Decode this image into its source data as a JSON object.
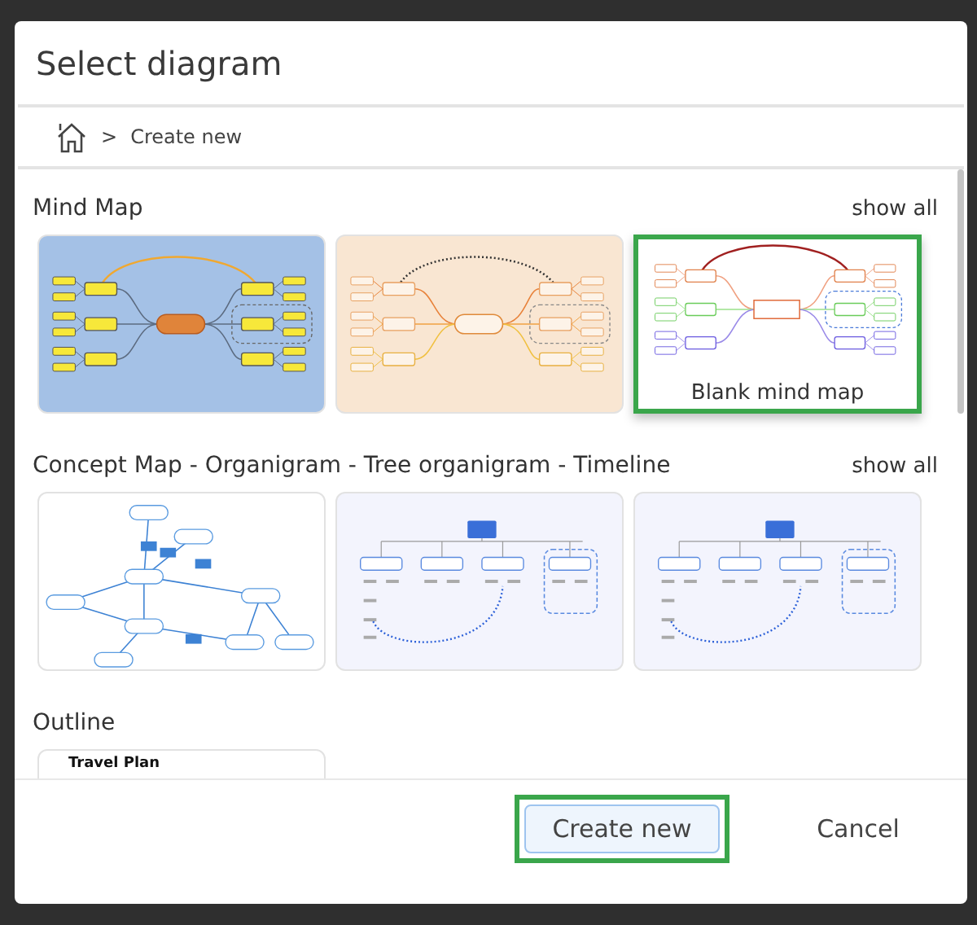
{
  "dialog": {
    "title": "Select diagram"
  },
  "breadcrumb": {
    "separator": ">",
    "current": "Create new"
  },
  "sections": [
    {
      "title": "Mind Map",
      "show_all": "show all",
      "templates": [
        {
          "kind": "mindmap-blue",
          "selected": false
        },
        {
          "kind": "mindmap-orange",
          "selected": false
        },
        {
          "kind": "mindmap-blank",
          "selected": true,
          "label": "Blank mind map"
        }
      ]
    },
    {
      "title": "Concept Map - Organigram - Tree organigram - Timeline",
      "show_all": "show all",
      "templates": [
        {
          "kind": "concept",
          "selected": false
        },
        {
          "kind": "org",
          "selected": false
        },
        {
          "kind": "org",
          "selected": false
        }
      ]
    },
    {
      "title": "Outline",
      "templates": [
        {
          "kind": "outline",
          "selected": false,
          "heading": "Travel Plan"
        }
      ]
    }
  ],
  "buttons": [
    {
      "label": "Create new",
      "kind": "primary",
      "focused": true
    },
    {
      "label": "Cancel",
      "kind": "plain",
      "focused": false
    }
  ]
}
